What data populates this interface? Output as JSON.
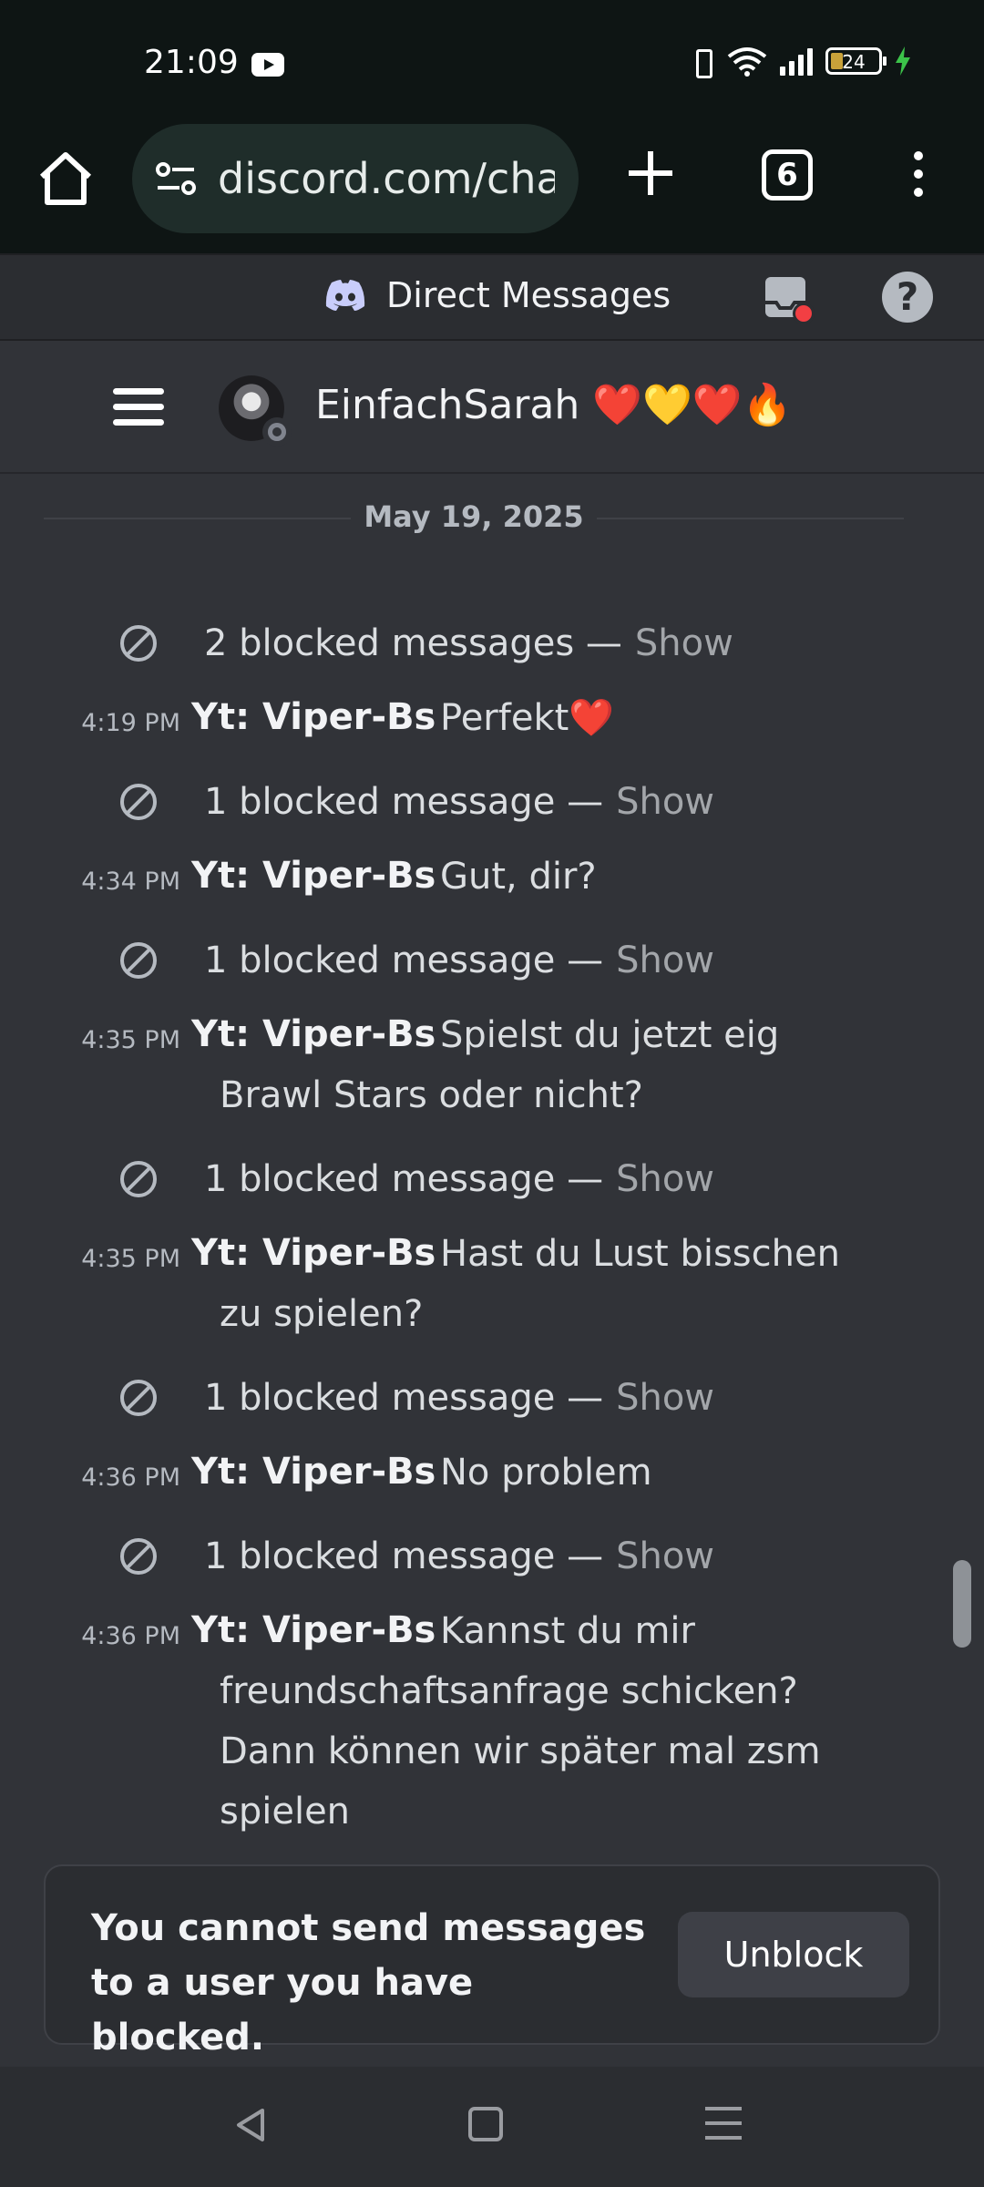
{
  "status_bar": {
    "time": "21:09",
    "battery_percent": "24"
  },
  "browser": {
    "url": "discord.com/channels/@me",
    "tab_count": "6"
  },
  "dm_header": {
    "title": "Direct Messages"
  },
  "channel": {
    "name": "EinfachSarah ❤️💛❤️🔥"
  },
  "date_divider": "May 19, 2025",
  "blocked_rows": [
    {
      "text": "2 blocked messages —",
      "action": "Show"
    },
    {
      "text": "1 blocked message —",
      "action": "Show"
    },
    {
      "text": "1 blocked message —",
      "action": "Show"
    },
    {
      "text": "1 blocked message —",
      "action": "Show"
    },
    {
      "text": "1 blocked message —",
      "action": "Show"
    },
    {
      "text": "1 blocked message —",
      "action": "Show"
    }
  ],
  "messages": [
    {
      "time": "4:19 PM",
      "author": "Yt: Viper-Bs",
      "lines": [
        "Perfekt❤️"
      ]
    },
    {
      "time": "4:34 PM",
      "author": "Yt: Viper-Bs",
      "lines": [
        "Gut, dir?"
      ]
    },
    {
      "time": "4:35 PM",
      "author": "Yt: Viper-Bs",
      "lines": [
        "Spielst du jetzt eig",
        "Brawl Stars oder nicht?"
      ]
    },
    {
      "time": "4:35 PM",
      "author": "Yt: Viper-Bs",
      "lines": [
        "Hast du Lust bisschen",
        "zu spielen?"
      ]
    },
    {
      "time": "4:36 PM",
      "author": "Yt: Viper-Bs",
      "lines": [
        "No problem"
      ]
    },
    {
      "time": "4:36 PM",
      "author": "Yt: Viper-Bs",
      "lines": [
        "Kannst du mir",
        "freundschaftsanfrage schicken?",
        "Dann können wir später mal zsm",
        "spielen"
      ]
    }
  ],
  "blocked_banner": {
    "line1": "You cannot send messages",
    "line2": "to a user you have blocked.",
    "button_label": "Unblock"
  },
  "colors": {
    "background": "#313338",
    "header": "#2b2d31",
    "browser_chrome": "#0e1514",
    "notification_dot": "#f23f43"
  }
}
